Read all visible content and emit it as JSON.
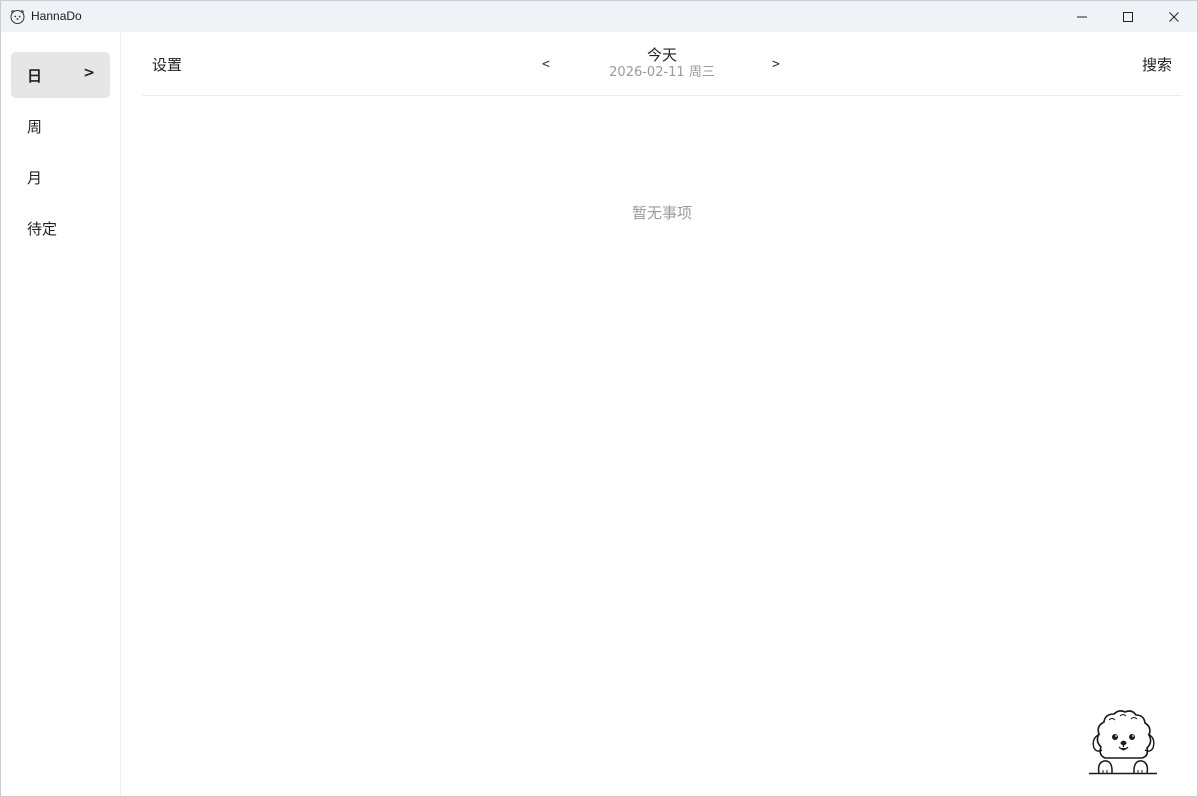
{
  "window": {
    "title": "HannaDo",
    "app_icon": "dog-face-icon",
    "controls": [
      "minimize-icon",
      "maximize-icon",
      "close-icon"
    ]
  },
  "sidebar": {
    "items": [
      {
        "label": "日",
        "active": true,
        "arrow": ">"
      },
      {
        "label": "周",
        "active": false
      },
      {
        "label": "月",
        "active": false
      },
      {
        "label": "待定",
        "active": false
      }
    ]
  },
  "header": {
    "settings_label": "设置",
    "prev_label": "<",
    "next_label": ">",
    "today_label": "今天",
    "date_text": "2026-02-11 周三",
    "search_label": "搜索"
  },
  "main": {
    "empty_text": "暂无事项"
  },
  "decor": {
    "mascot": "dog-mascot-icon"
  },
  "colors": {
    "titlebar_bg": "#eff3f8",
    "active_nav_bg": "#e6e6e6",
    "muted_text": "#9a9a9a"
  }
}
